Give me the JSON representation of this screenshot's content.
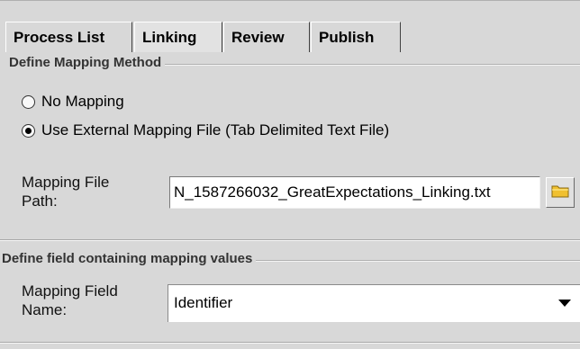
{
  "tabs": {
    "items": [
      {
        "label": "Process List"
      },
      {
        "label": "Linking"
      },
      {
        "label": "Review"
      },
      {
        "label": "Publish"
      }
    ],
    "active": "Linking"
  },
  "mapping_method": {
    "title": "Define Mapping Method",
    "options": [
      {
        "label": "No Mapping",
        "selected": false
      },
      {
        "label": "Use External Mapping File (Tab Delimited Text File)",
        "selected": true
      }
    ],
    "file_path": {
      "label_line1": "Mapping File",
      "label_line2": "Path:",
      "value": "N_1587266032_GreatExpectations_Linking.txt",
      "browse_icon": "folder-icon"
    }
  },
  "mapping_field": {
    "title": "Define field containing mapping values",
    "field": {
      "label_line1": "Mapping Field",
      "label_line2": "Name:",
      "selected": "Identifier",
      "dropdown_icon": "chevron-down-icon"
    }
  },
  "colors": {
    "background": "#d8d8d8",
    "field": "#ffffff",
    "folder": "#f0c030"
  }
}
